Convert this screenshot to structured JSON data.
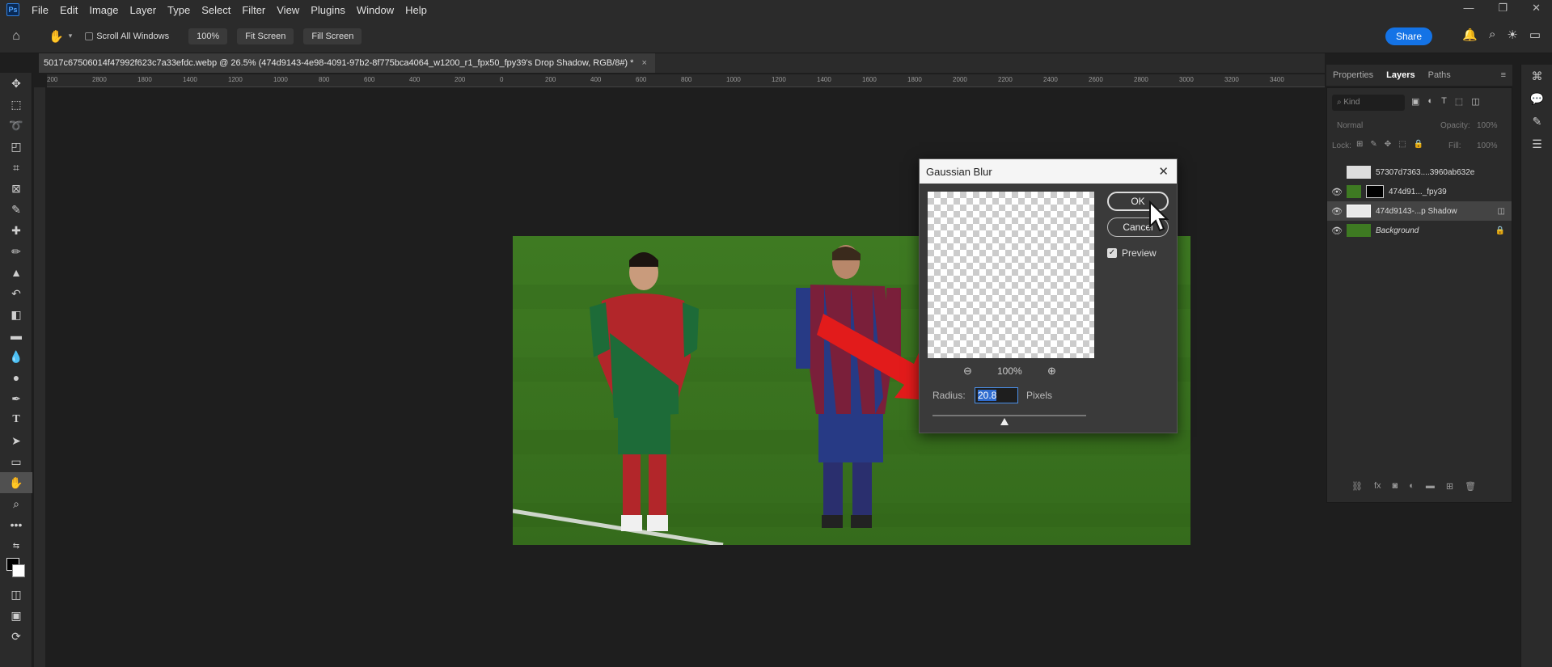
{
  "menu": {
    "app_icon": "photoshop-logo",
    "items": [
      "File",
      "Edit",
      "Image",
      "Layer",
      "Type",
      "Select",
      "Filter",
      "View",
      "Plugins",
      "Window",
      "Help"
    ]
  },
  "options": {
    "scroll_all_windows": "Scroll All Windows",
    "zoom_btn": "100%",
    "fit_screen": "Fit Screen",
    "fill_screen": "Fill Screen",
    "share": "Share"
  },
  "document_tab": {
    "title": "5017c67506014f47992f623c7a33efdc.webp @ 26.5% (474d9143-4e98-4091-97b2-8f775bca4064_w1200_r1_fpx50_fpy39's Drop Shadow, RGB/8#) *"
  },
  "ruler_ticks": [
    "200",
    "2800",
    "1800",
    "1400",
    "1200",
    "1000",
    "800",
    "600",
    "400",
    "200",
    "0",
    "200",
    "400",
    "600",
    "800",
    "1000",
    "1200",
    "1400",
    "1600",
    "1800",
    "2000",
    "2200",
    "2400",
    "2600",
    "2800",
    "3000",
    "3200",
    "3400"
  ],
  "dialog": {
    "title": "Gaussian Blur",
    "ok": "OK",
    "cancel": "Cancel",
    "preview_label": "Preview",
    "zoom_level": "100%",
    "radius_label": "Radius:",
    "radius_value": "20.8",
    "radius_unit": "Pixels"
  },
  "panels": {
    "tabs": [
      "Properties",
      "Layers",
      "Paths"
    ],
    "active_tab": "Layers",
    "kind_placeholder": "Kind",
    "blend_mode": "Normal",
    "opacity_label": "Opacity:",
    "opacity_value": "100%",
    "lock_label": "Lock:",
    "fill_label": "Fill:",
    "fill_value": "100%",
    "layers": [
      {
        "name": "57307d7363....3960ab632e",
        "visible": false,
        "selected": false
      },
      {
        "name": "474d91..._fpy39",
        "visible": true,
        "selected": false
      },
      {
        "name": "474d9143-...p Shadow",
        "visible": true,
        "selected": true
      },
      {
        "name": "Background",
        "visible": true,
        "selected": false
      }
    ]
  },
  "colors": {
    "accent": "#1473e6",
    "annotation_arrow": "#e21b1b"
  }
}
